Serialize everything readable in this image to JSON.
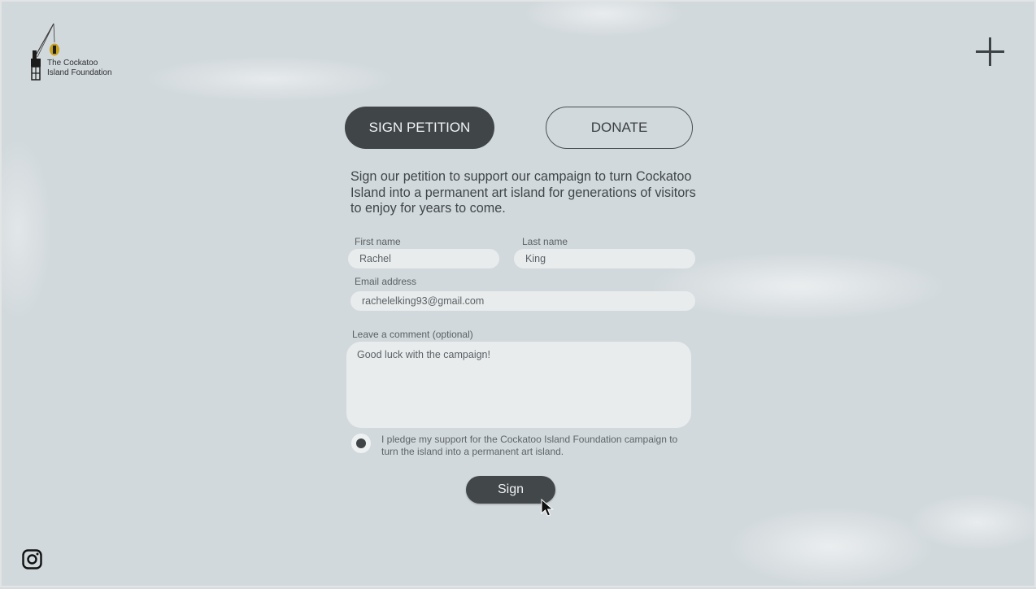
{
  "brand": {
    "logo_line1": "The Cockatoo",
    "logo_line2": "Island Foundation",
    "icon": "crane-logo"
  },
  "header": {
    "menu_icon": "plus-icon"
  },
  "tabs": [
    {
      "label": "SIGN PETITION",
      "active": true
    },
    {
      "label": "DONATE",
      "active": false
    }
  ],
  "intro_text": "Sign our petition to support our campaign to turn Cockatoo Island into a permanent art island for generations of visitors to enjoy for years to come.",
  "form": {
    "first_name": {
      "label": "First name",
      "value": "Rachel"
    },
    "last_name": {
      "label": "Last name",
      "value": "King"
    },
    "email": {
      "label": "Email address",
      "value": "rachelelking93@gmail.com"
    },
    "comment": {
      "label": "Leave a comment (optional)",
      "value": "Good luck with the campaign!"
    },
    "pledge_text": "I pledge my support for the Cockatoo Island Foundation campaign to turn the island into a permanent art island.",
    "pledge_checked": true,
    "submit_label": "Sign"
  },
  "footer": {
    "social_icon": "instagram-icon"
  },
  "colors": {
    "dark": "#404547",
    "field": "#e8eced",
    "background": "#d2d9dc"
  }
}
